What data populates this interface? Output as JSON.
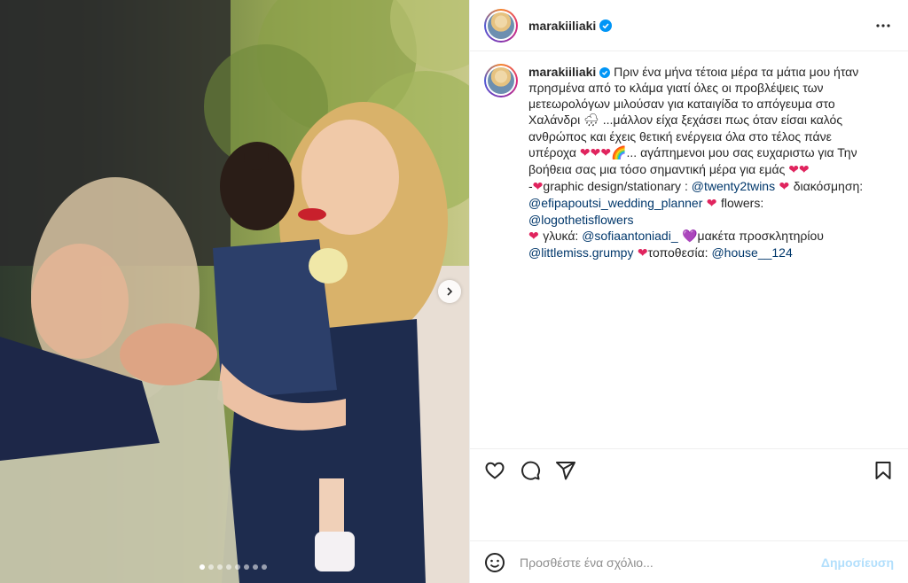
{
  "post": {
    "username": "marakiiliaki",
    "verified": true,
    "slides_total": 8,
    "active_slide": 1
  },
  "caption": {
    "username": "marakiiliaki",
    "p1": "Πριν ένα μήνα τέτοια μέρα τα μάτια μου ήταν πρησμένα από το κλάμα γιατί όλες οι προβλέψεις των μετεωρολόγων μιλούσαν για καταιγίδα το απόγευμα στο Χαλάνδρι ",
    "emoji_rain": "🌧",
    "p2": " ...μάλλον είχα ξεχάσει πως όταν είσαι καλός ανθρώπος και έχεις θετική ενέργεια όλα στο τέλος πάνε υπέροχα ",
    "hearts3": "❤❤❤",
    "emoji_rainbow": "🌈",
    "p3": "... αγάπημενοι μου σας ευχαριστω για Την βοήθεια σας μια τόσο σημαντική μέρα για εμάς ",
    "hearts2": "❤❤",
    "dash": "-",
    "heart_a": "❤",
    "l1": "graphic design/stationary : ",
    "m1": "@twenty2twins",
    "heart_b": " ❤ ",
    "l2": "διακόσμηση: ",
    "m2": "@efipapoutsi_wedding_planner",
    "heart_c": " ❤ ",
    "l3": "flowers: ",
    "m3": "@logothetisflowers",
    "heart_d": "❤ ",
    "l4": "γλυκά: ",
    "m4": "@sofiaantoniadi_",
    "heart_purple": " 💜",
    "l5": "μακέτα προσκλητηρίου ",
    "m5": "@littlemiss.grumpy",
    "heart_e": " ❤",
    "l6": "τοποθεσία: ",
    "m6": "@house__124"
  },
  "icons": {
    "like": "heart-outline-icon",
    "comment": "comment-bubble-icon",
    "share": "paper-plane-icon",
    "save": "bookmark-icon",
    "emoji": "smiley-icon",
    "more": "ellipsis-icon",
    "next": "chevron-right-icon"
  },
  "comment_box": {
    "placeholder": "Προσθέστε ένα σχόλιο...",
    "post_label": "Δημοσίευση"
  },
  "colors": {
    "mention": "#00376b",
    "verified": "#0095f6",
    "post_disabled": "#b2dffc"
  }
}
